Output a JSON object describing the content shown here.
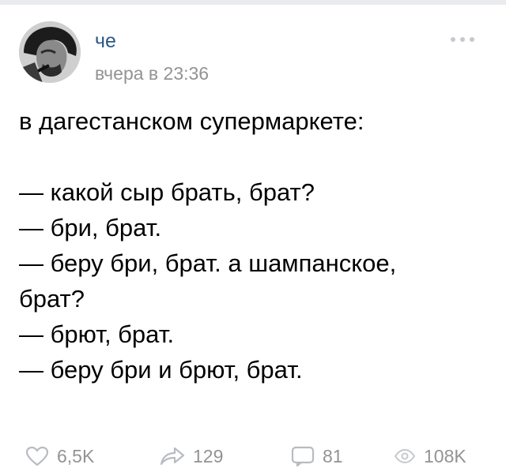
{
  "post": {
    "author": "че",
    "time": "вчера в 23:36",
    "lines": [
      "в дагестанском супермаркете:",
      "",
      "— какой сыр брать, брат?",
      "— бри, брат.",
      "— беру бри, брат. а шампанское,",
      "брат?",
      "— брют, брат.",
      "— беру бри и брют, брат."
    ]
  },
  "footer": {
    "likes": "6,5K",
    "shares": "129",
    "comments": "81",
    "views": "108K"
  },
  "icons": {
    "more": "more-dots-icon",
    "like": "heart-icon",
    "share": "share-arrow-icon",
    "comment": "comment-icon",
    "views": "eye-icon"
  },
  "colors": {
    "author_link": "#2a5885",
    "secondary_text": "#939393",
    "footer_icon": "#b7bcc2"
  }
}
